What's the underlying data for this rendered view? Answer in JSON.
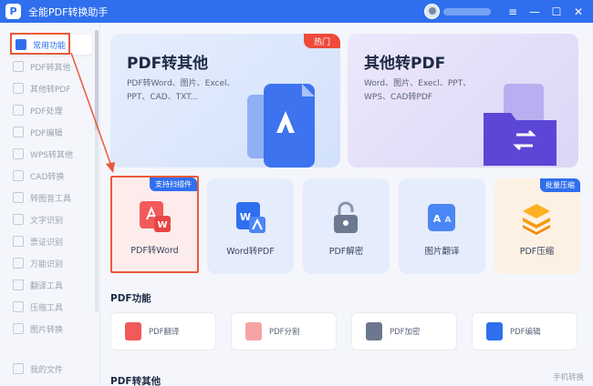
{
  "titlebar": {
    "app_title": "全能PDF转换助手",
    "logo_glyph": "P",
    "min_icon": "—",
    "max_icon": "☐",
    "close_icon": "✕",
    "menu_icon": "≡"
  },
  "sidebar": {
    "items": [
      {
        "label": "常用功能"
      },
      {
        "label": "PDF转其他"
      },
      {
        "label": "其他转PDF"
      },
      {
        "label": "PDF处理"
      },
      {
        "label": "PDF编辑"
      },
      {
        "label": "WPS转其他"
      },
      {
        "label": "CAD转换"
      },
      {
        "label": "转图音工具"
      },
      {
        "label": "文字识别"
      },
      {
        "label": "票证识别"
      },
      {
        "label": "万能识别"
      },
      {
        "label": "翻译工具"
      },
      {
        "label": "压缩工具"
      },
      {
        "label": "图片转换"
      }
    ],
    "footer_label": "我的文件"
  },
  "heroes": [
    {
      "title": "PDF转其他",
      "desc": "PDF转Word、图片、Excel、PPT、CAD、TXT...",
      "badge": "热门"
    },
    {
      "title": "其他转PDF",
      "desc": "Word、图片、Execl、PPT、WPS、CAD转PDF"
    }
  ],
  "tools": [
    {
      "label": "PDF转Word",
      "badge": "支持扫描件"
    },
    {
      "label": "Word转PDF"
    },
    {
      "label": "PDF解密"
    },
    {
      "label": "图片翻译"
    },
    {
      "label": "PDF压缩",
      "badge": "批量压缩"
    }
  ],
  "sections": {
    "pdf_functions": "PDF功能",
    "pdf_to_other": "PDF转其他",
    "phone_convert": "手机转换"
  },
  "functions": [
    {
      "label": "PDF翻译"
    },
    {
      "label": "PDF分割"
    },
    {
      "label": "PDF加密"
    },
    {
      "label": "PDF编辑"
    }
  ],
  "colors": {
    "accent": "#2f6fee",
    "hot": "#ef4a3b",
    "annotation": "#ea5a3a"
  }
}
